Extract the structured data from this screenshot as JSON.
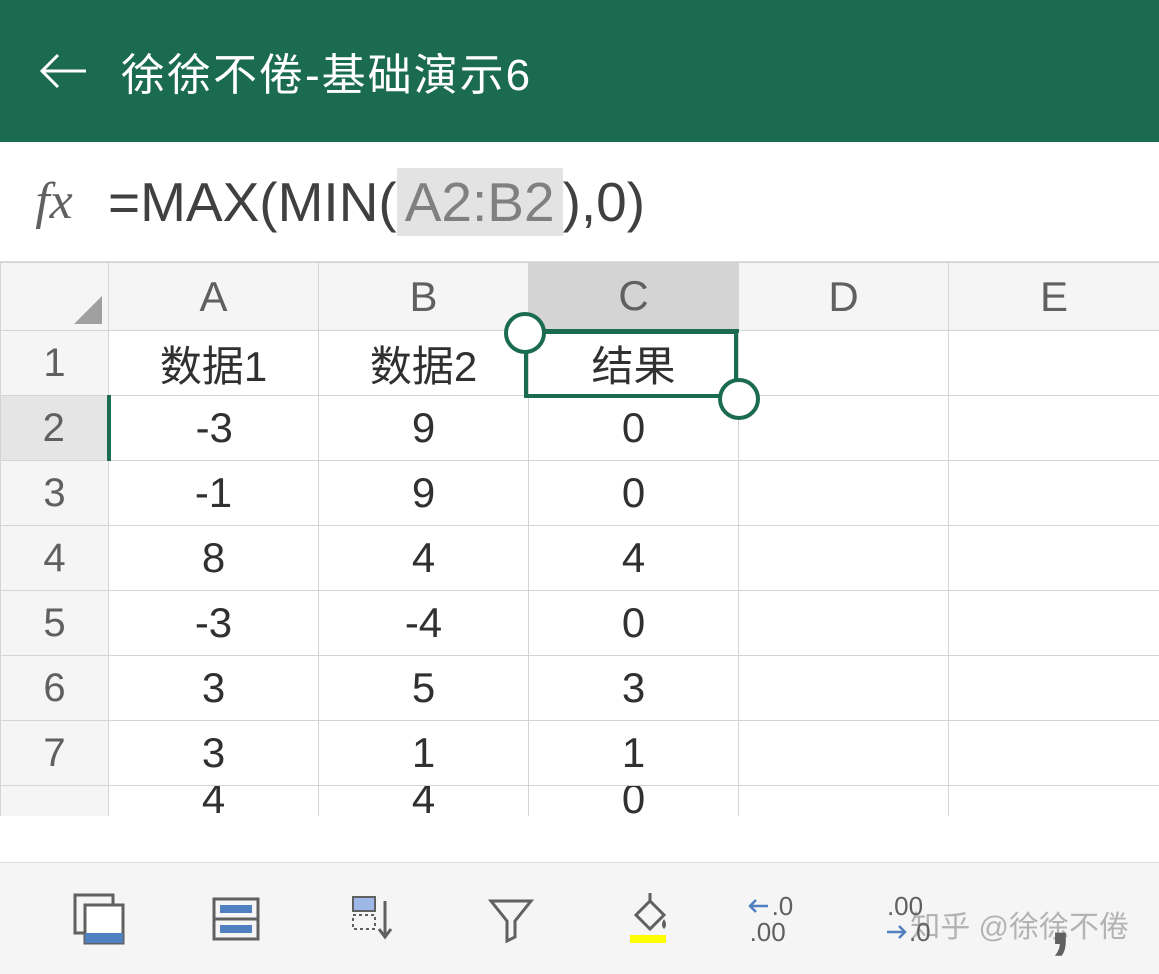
{
  "header": {
    "title": "徐徐不倦-基础演示6"
  },
  "formulaBar": {
    "fxLabel": "fx",
    "prefix": "=MAX(MIN( ",
    "highlighted": "A2:B2",
    "suffix": " ),0)"
  },
  "columns": [
    "A",
    "B",
    "C",
    "D",
    "E"
  ],
  "selectedColumn": "C",
  "selectedRow": 2,
  "headerRow": {
    "rowNum": "1",
    "cells": [
      "数据1",
      "数据2",
      "结果",
      "",
      ""
    ]
  },
  "dataRows": [
    {
      "rowNum": "2",
      "cells": [
        "-3",
        "9",
        "0",
        "",
        ""
      ]
    },
    {
      "rowNum": "3",
      "cells": [
        "-1",
        "9",
        "0",
        "",
        ""
      ]
    },
    {
      "rowNum": "4",
      "cells": [
        "8",
        "4",
        "4",
        "",
        ""
      ]
    },
    {
      "rowNum": "5",
      "cells": [
        "-3",
        "-4",
        "0",
        "",
        ""
      ]
    },
    {
      "rowNum": "6",
      "cells": [
        "3",
        "5",
        "3",
        "",
        ""
      ]
    },
    {
      "rowNum": "7",
      "cells": [
        "3",
        "1",
        "1",
        "",
        ""
      ]
    }
  ],
  "partialRow": {
    "rowNum": "",
    "cells": [
      "4",
      "4",
      "0",
      "",
      ""
    ]
  },
  "toolbar": {
    "decreaseDecimal": {
      "line1": ".0",
      "line2": ".00"
    },
    "increaseDecimal": {
      "line1": ".00",
      "line2": ".0"
    }
  },
  "watermark": "知乎 @徐徐不倦"
}
